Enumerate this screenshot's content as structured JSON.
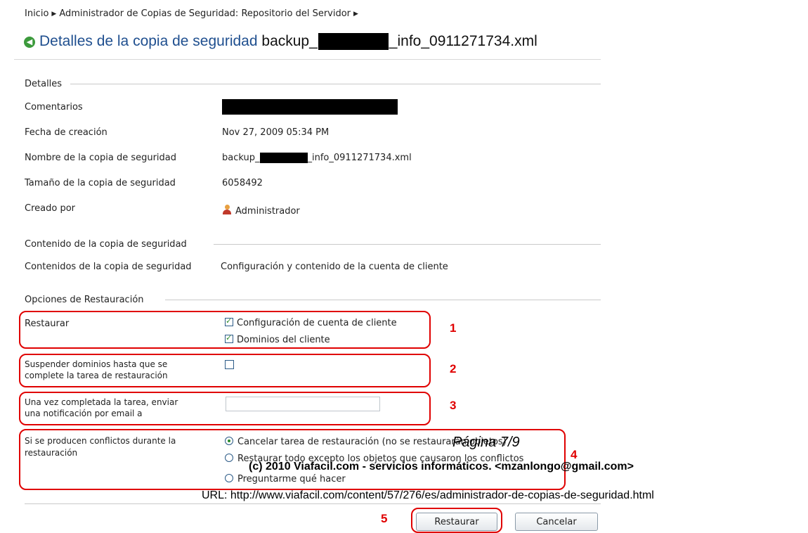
{
  "breadcrumb": {
    "items": [
      "Inicio",
      "Administrador de Copias de Seguridad: Repositorio del Servidor"
    ]
  },
  "title": {
    "main": "Detalles de la copia de seguridad",
    "file_prefix": "backup_",
    "file_suffix": "_info_0911271734.xml"
  },
  "details": {
    "section": "Detalles",
    "rows": [
      {
        "label": "Comentarios",
        "value": ""
      },
      {
        "label": "Fecha de creación",
        "value": "Nov 27, 2009 05:34 PM"
      },
      {
        "label": "Nombre de la copia de seguridad",
        "value_prefix": "backup_",
        "value_suffix": "_info_0911271734.xml"
      },
      {
        "label": "Tamaño de la copia de seguridad",
        "value": "6058492"
      },
      {
        "label": "Creado por",
        "value": "Administrador",
        "icon": "user-icon"
      }
    ]
  },
  "content": {
    "section": "Contenido de la copia de seguridad",
    "label": "Contenidos de la copia de seguridad",
    "value": "Configuración y contenido de la cuenta de cliente"
  },
  "options": {
    "section": "Opciones de Restauración",
    "restore": {
      "label": "Restaurar",
      "checkboxes": [
        {
          "label": "Configuración de cuenta de cliente",
          "checked": true
        },
        {
          "label": "Dominios del cliente",
          "checked": true
        }
      ]
    },
    "suspend": {
      "label_line1": "Suspender dominios hasta que se",
      "label_line2": "complete la tarea de restauración",
      "checked": false
    },
    "notify": {
      "label_line1": "Una vez completada la tarea, enviar",
      "label_line2": "una notificación por email a",
      "value": ""
    },
    "conflicts": {
      "label_line1": "Si se producen conflictos durante la",
      "label_line2": "restauración",
      "radios": [
        {
          "label": "Cancelar tarea de restauración (no se restaurarán objetos)",
          "selected": true
        },
        {
          "label": "Restaurar todo excepto los objetos que causaron los conflictos",
          "selected": false
        },
        {
          "label": "Preguntarme qué hacer",
          "selected": false
        }
      ]
    }
  },
  "buttons": {
    "restore": "Restaurar",
    "cancel": "Cancelar"
  },
  "annotations": [
    "1",
    "2",
    "3",
    "4",
    "5"
  ],
  "overlay": {
    "page": "Página 7/9",
    "copyright": "(c) 2010 Viafacil.com - servicios informáticos. <mzanlongo@gmail.com>",
    "url": "URL: http://www.viafacil.com/content/57/276/es/administrador-de-copias-de-seguridad.html"
  },
  "colors": {
    "title_blue": "#1f4f8f",
    "annotation_red": "#e00000",
    "check_green": "#2a8a2a"
  }
}
